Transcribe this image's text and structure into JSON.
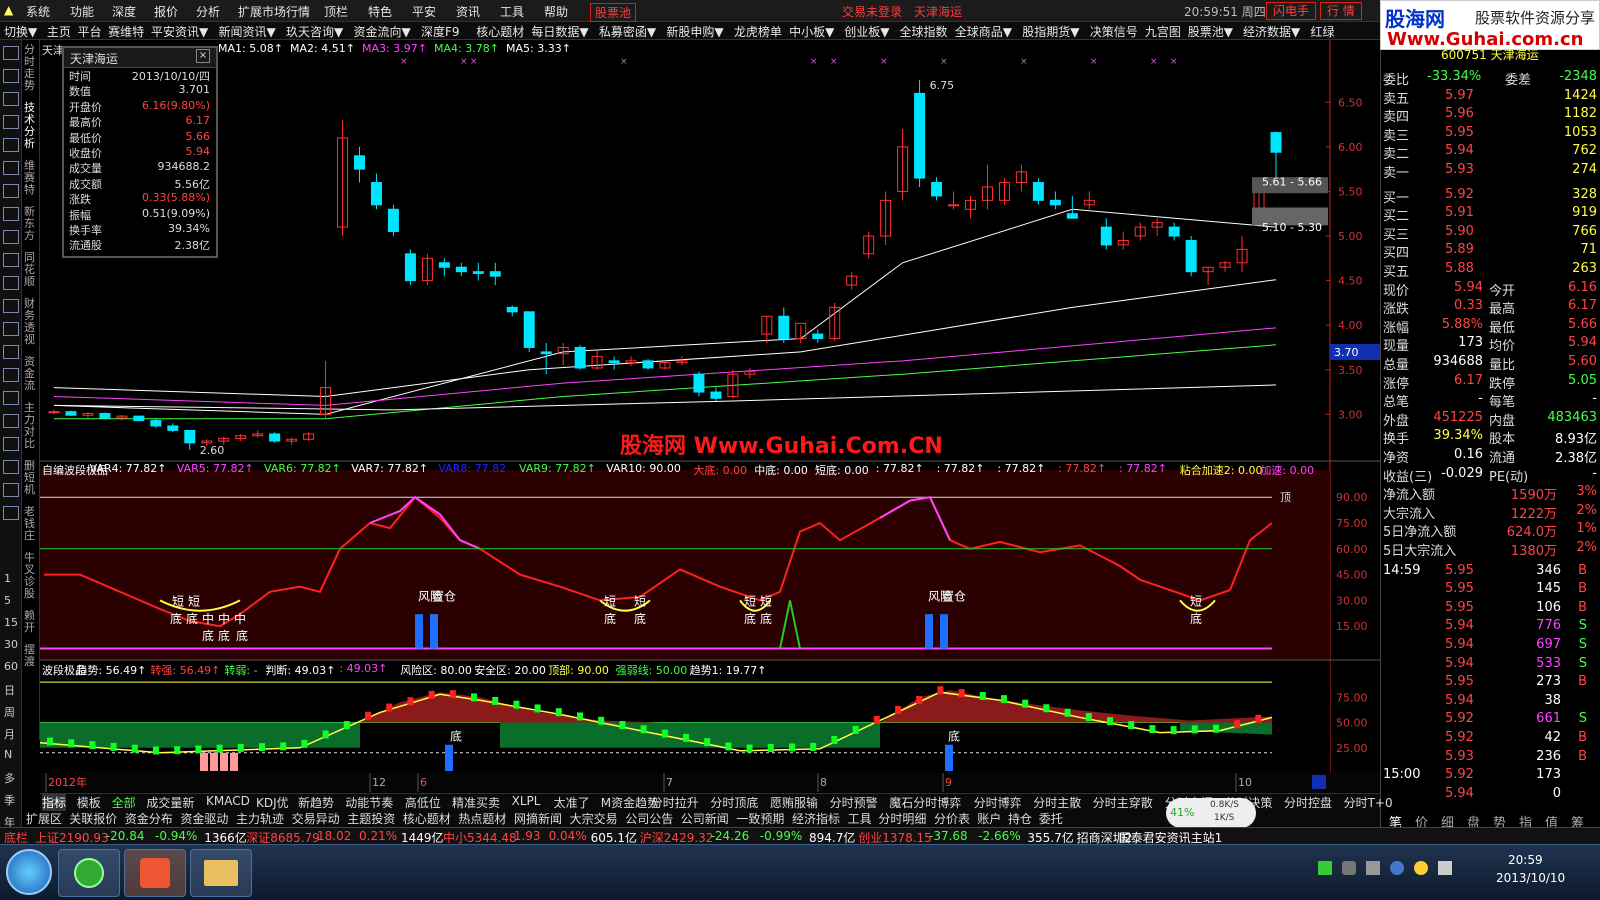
{
  "menubar": {
    "items": [
      "系统",
      "功能",
      "深度",
      "报价",
      "分析",
      "扩展市场行情",
      "顶栏",
      "特色",
      "平安",
      "资讯",
      "工具",
      "帮助"
    ],
    "stock_pool": "股票池",
    "login_status": "交易未登录",
    "stock_name": "天津海运",
    "clock": "20:59:51 周四",
    "flash_btn": "闪电手",
    "quote_btn": "行 情"
  },
  "toolbar": {
    "items": [
      "切换▼",
      "主页",
      "平台",
      "赛维特",
      "平安资讯▼",
      "新闻资讯▼",
      "玖天咨询▼",
      "资金流向▼",
      "深度F9",
      "核心题材",
      "每日数据▼",
      "私募密函▼",
      "新股申购▼",
      "龙虎榜单",
      "中小板▼",
      "创业板▼",
      "全球指数",
      "全球商品▼",
      "股指期货▼",
      "决策信号",
      "九宫图",
      "股票池▼",
      "经济数据▼",
      "红绿"
    ]
  },
  "logo": {
    "name": "股海网",
    "slogan": "股票软件资源分享",
    "url": "Www.Guhai.com.cn"
  },
  "watermark": "股海网 Www.Guhai.Com.CN",
  "left_rail": {
    "icons": [
      "lock-icon",
      "arrow-up-icon",
      "arrow-down-icon",
      "list-icon",
      "grid-icon",
      "line-icon",
      "kline-icon",
      "table-icon",
      "f10-icon",
      "chart-icon",
      "calendar-icon",
      "fiz-icon",
      "f10b-icon",
      "circle-icon",
      "wave-icon",
      "rsi-icon",
      "dollar-icon",
      "cross-icon",
      "pen-icon",
      "f5-icon",
      "book-icon"
    ],
    "periods": [
      "1",
      "5",
      "15",
      "30",
      "60",
      "日",
      "周",
      "月",
      "N",
      "多",
      "季",
      "年"
    ]
  },
  "vtabs": [
    "分时走势",
    "技术分析",
    "维赛特",
    "新东方",
    "同花顺",
    "财务透视",
    "资金流",
    "主力对比",
    "删短机",
    "老钱庄",
    "牛叉诊股",
    "赖开",
    "摆渡"
  ],
  "main_panel": {
    "stock_label": "天津",
    "ma_line": [
      {
        "label": "MA1: 5.08↑",
        "color": "#ffffff"
      },
      {
        "label": "MA2: 4.51↑",
        "color": "#ffffff"
      },
      {
        "label": "MA3: 3.97↑",
        "color": "#ff44ff"
      },
      {
        "label": "MA4: 3.78↑",
        "color": "#44ff44"
      },
      {
        "label": "MA5: 3.33↑",
        "color": "#ffffff"
      }
    ],
    "price_high": "6.75",
    "price_low": "2.60",
    "zone_high": "5.61 - 5.66",
    "zone_low": "5.10 - 5.30",
    "current_tag": "3.70",
    "y_ticks": [
      "6.50",
      "6.00",
      "5.50",
      "5.00",
      "4.50",
      "4.00",
      "3.50",
      "3.00"
    ]
  },
  "info_box": {
    "title": "天津海运",
    "close": "×",
    "rows": [
      {
        "k": "时间",
        "v": "2013/10/10/四",
        "c": "#dddddd"
      },
      {
        "k": "数值",
        "v": "3.701",
        "c": "#dddddd"
      },
      {
        "k": "开盘价",
        "v": "6.16(9.80%)",
        "c": "#ff4444"
      },
      {
        "k": "最高价",
        "v": "6.17",
        "c": "#ff4444"
      },
      {
        "k": "最低价",
        "v": "5.66",
        "c": "#ff4444"
      },
      {
        "k": "收盘价",
        "v": "5.94",
        "c": "#ff4444"
      },
      {
        "k": "成交量",
        "v": "934688.2",
        "c": "#dddddd"
      },
      {
        "k": "成交额",
        "v": "5.56亿",
        "c": "#dddddd"
      },
      {
        "k": "涨跌",
        "v": "0.33(5.88%)",
        "c": "#ff4444"
      },
      {
        "k": "振幅",
        "v": "0.51(9.09%)",
        "c": "#dddddd"
      },
      {
        "k": "换手率",
        "v": "39.34%",
        "c": "#dddddd"
      },
      {
        "k": "流通股",
        "v": "2.38亿",
        "c": "#dddddd"
      }
    ]
  },
  "indicator1": {
    "header": [
      {
        "t": "自编波段极品",
        "c": "#ffffff"
      },
      {
        "t": "VAR4: 77.82↑",
        "c": "#ffffff"
      },
      {
        "t": "VAR5: 77.82↑",
        "c": "#ff44ff"
      },
      {
        "t": "VAR6: 77.82↑",
        "c": "#44ff44"
      },
      {
        "t": "VAR7: 77.82↑",
        "c": "#ffffff"
      },
      {
        "t": "VAR8: 77.82",
        "c": "#2222ff"
      },
      {
        "t": "VAR9: 77.82↑",
        "c": "#44ff44"
      },
      {
        "t": "VAR10: 90.00",
        "c": "#ffffff"
      },
      {
        "t": "大底: 0.00",
        "c": "#ff4444"
      },
      {
        "t": "中底: 0.00",
        "c": "#ffffff"
      },
      {
        "t": "短底: 0.00",
        "c": "#ffffff"
      },
      {
        "t": ": 77.82↑",
        "c": "#ffffff"
      },
      {
        "t": ": 77.82↑",
        "c": "#ffffff"
      },
      {
        "t": ": 77.82↑",
        "c": "#ffffff"
      },
      {
        "t": ": 77.82↑",
        "c": "#ff4444"
      },
      {
        "t": ": 77.82↑",
        "c": "#ff44ff"
      },
      {
        "t": "粘合加速2: 0.00",
        "c": "#ffff44"
      },
      {
        "t": "加速: 0.00",
        "c": "#ff44ff"
      }
    ],
    "y_ticks": [
      "90.00",
      "75.00",
      "60.00",
      "45.00",
      "30.00",
      "15.00"
    ],
    "top_label": "顶",
    "labels": {
      "short": "短",
      "bottom": "底",
      "mid": "中",
      "risk": "风险",
      "hold": "置仓"
    }
  },
  "indicator2": {
    "header": [
      {
        "t": "波段极品",
        "c": "#ffffff"
      },
      {
        "t": "趋势: 56.49↑",
        "c": "#ffffff"
      },
      {
        "t": "转强: 56.49↑",
        "c": "#ff4444"
      },
      {
        "t": "转弱: -",
        "c": "#44ff44"
      },
      {
        "t": "判断: 49.03↑",
        "c": "#ffffff"
      },
      {
        "t": ": 49.03↑",
        "c": "#ff44ff"
      },
      {
        "t": "风险区: 80.00",
        "c": "#ffffff"
      },
      {
        "t": "安全区: 20.00",
        "c": "#ffffff"
      },
      {
        "t": "顶部: 90.00",
        "c": "#ffff44"
      },
      {
        "t": "强弱线: 50.00",
        "c": "#44ff44"
      },
      {
        "t": "趋势1: 19.77↑",
        "c": "#ffffff"
      }
    ],
    "y_ticks": [
      "75.00",
      "50.00",
      "25.00"
    ],
    "bottom_label": "底"
  },
  "x_axis": {
    "labels": [
      {
        "t": "2012年",
        "c": "#ff4444"
      },
      {
        "t": "12",
        "c": "#aaaaaa"
      },
      {
        "t": "6",
        "c": "#ff4444"
      },
      {
        "t": "7",
        "c": "#aaaaaa"
      },
      {
        "t": "8",
        "c": "#aaaaaa"
      },
      {
        "t": "9",
        "c": "#ff4444"
      },
      {
        "t": "10",
        "c": "#aaaaaa"
      }
    ]
  },
  "right_panel": {
    "header": "600751 天津海运",
    "webi": {
      "k": "委比",
      "v": "-33.34%",
      "k2": "委差",
      "v2": "-2348"
    },
    "asks": [
      {
        "k": "卖五",
        "p": "5.97",
        "v": "1424"
      },
      {
        "k": "卖四",
        "p": "5.96",
        "v": "1182"
      },
      {
        "k": "卖三",
        "p": "5.95",
        "v": "1053"
      },
      {
        "k": "卖二",
        "p": "5.94",
        "v": "762"
      },
      {
        "k": "卖一",
        "p": "5.93",
        "v": "274"
      }
    ],
    "bids": [
      {
        "k": "买一",
        "p": "5.92",
        "v": "328"
      },
      {
        "k": "买二",
        "p": "5.91",
        "v": "919"
      },
      {
        "k": "买三",
        "p": "5.90",
        "v": "766"
      },
      {
        "k": "买四",
        "p": "5.89",
        "v": "71"
      },
      {
        "k": "买五",
        "p": "5.88",
        "v": "263"
      }
    ],
    "stats": [
      {
        "k1": "现价",
        "v1": "5.94",
        "k2": "今开",
        "v2": "6.16",
        "c1": "#ff4444",
        "c2": "#ff4444"
      },
      {
        "k1": "涨跌",
        "v1": "0.33",
        "k2": "最高",
        "v2": "6.17",
        "c1": "#ff4444",
        "c2": "#ff4444"
      },
      {
        "k1": "涨幅",
        "v1": "5.88%",
        "k2": "最低",
        "v2": "5.66",
        "c1": "#ff4444",
        "c2": "#ff4444"
      },
      {
        "k1": "现量",
        "v1": "173",
        "k2": "均价",
        "v2": "5.94",
        "c1": "#ffffff",
        "c2": "#ff4444"
      },
      {
        "k1": "总量",
        "v1": "934688",
        "k2": "量比",
        "v2": "5.60",
        "c1": "#ffffff",
        "c2": "#ff4444"
      },
      {
        "k1": "涨停",
        "v1": "6.17",
        "k2": "跌停",
        "v2": "5.05",
        "c1": "#ff4444",
        "c2": "#44ff44"
      },
      {
        "k1": "总笔",
        "v1": "-",
        "k2": "每笔",
        "v2": "-",
        "c1": "#ffffff",
        "c2": "#ffffff"
      },
      {
        "k1": "外盘",
        "v1": "451225",
        "k2": "内盘",
        "v2": "483463",
        "c1": "#ff4444",
        "c2": "#44ff44"
      },
      {
        "k1": "换手",
        "v1": "39.34%",
        "k2": "股本",
        "v2": "8.93亿",
        "c1": "#ffff44",
        "c2": "#ffffff"
      },
      {
        "k1": "净资",
        "v1": "0.16",
        "k2": "流通",
        "v2": "2.38亿",
        "c1": "#ffffff",
        "c2": "#ffffff"
      },
      {
        "k1": "收益(三)",
        "v1": "-0.029",
        "k2": "PE(动)",
        "v2": "-",
        "c1": "#ffffff",
        "c2": "#ffffff"
      }
    ],
    "flows": [
      {
        "k": "净流入额",
        "v": "1590万",
        "p": "3%"
      },
      {
        "k": "大宗流入",
        "v": "1222万",
        "p": "2%"
      },
      {
        "k": "5日净流入额",
        "v": "624.0万",
        "p": "1%"
      },
      {
        "k": "5日大宗流入",
        "v": "1380万",
        "p": "2%"
      }
    ],
    "ticks": [
      {
        "t": "14:59",
        "p": "5.95",
        "v": "346",
        "s": "B"
      },
      {
        "t": "",
        "p": "5.95",
        "v": "145",
        "s": "B"
      },
      {
        "t": "",
        "p": "5.95",
        "v": "106",
        "s": "B"
      },
      {
        "t": "",
        "p": "5.94",
        "v": "776",
        "s": "S"
      },
      {
        "t": "",
        "p": "5.94",
        "v": "697",
        "s": "S"
      },
      {
        "t": "",
        "p": "5.94",
        "v": "533",
        "s": "S"
      },
      {
        "t": "",
        "p": "5.95",
        "v": "273",
        "s": "B"
      },
      {
        "t": "",
        "p": "5.94",
        "v": "38",
        "s": ""
      },
      {
        "t": "",
        "p": "5.92",
        "v": "661",
        "s": "S"
      },
      {
        "t": "",
        "p": "5.92",
        "v": "42",
        "s": "B"
      },
      {
        "t": "",
        "p": "5.93",
        "v": "236",
        "s": "B"
      },
      {
        "t": "15:00",
        "p": "5.92",
        "v": "173",
        "s": ""
      },
      {
        "t": "",
        "p": "5.94",
        "v": "0",
        "s": ""
      }
    ],
    "switch": "切换",
    "tabs": [
      "笔",
      "价",
      "细",
      "盘",
      "势",
      "指",
      "值",
      "筹"
    ]
  },
  "bottom_tabs": {
    "row1": [
      "指标",
      "模板",
      "全部",
      "成交量新",
      "KMACD",
      "KDJ优",
      "新趋势",
      "动能节奏",
      "高低位",
      "精准买卖",
      "XLPL",
      "太准了",
      "M资金趋势",
      "分时拉升",
      "分时顶底",
      "愿贿服输",
      "分时预警",
      "魔石分时博弈",
      "分时博弈",
      "分时主散",
      "分时主穿散",
      "分时启爆",
      "分时决策",
      "分时控盘",
      "分时T+0"
    ],
    "row2": [
      "扩展区",
      "关联报价",
      "资金分布",
      "资金驱动",
      "主力轨迹",
      "交易异动",
      "主题投资",
      "核心题材",
      "热点题材",
      "网摘新闻",
      "大宗交易",
      "公司公告",
      "公司新闻",
      "一致预期",
      "经济指标",
      "工具",
      "分时明细",
      "分价表",
      "账户",
      "持仓",
      "委托"
    ],
    "net": {
      "pct": "41%",
      "up": "0.8K/S",
      "down": "1K/S"
    }
  },
  "ticker": [
    {
      "t": "底栏",
      "c": "#ff4444"
    },
    {
      "t": "上证2190.93",
      "c": "#ff4444"
    },
    {
      "t": "-20.84",
      "c": "#44ff44"
    },
    {
      "t": "-0.94%",
      "c": "#44ff44"
    },
    {
      "t": "1366亿",
      "c": "#ffffff"
    },
    {
      "t": "深证8685.79",
      "c": "#ff4444"
    },
    {
      "t": "18.02",
      "c": "#ff4444"
    },
    {
      "t": "0.21%",
      "c": "#ff4444"
    },
    {
      "t": "1449亿",
      "c": "#ffffff"
    },
    {
      "t": "中小5344.48",
      "c": "#ff4444"
    },
    {
      "t": "1.93",
      "c": "#ff4444"
    },
    {
      "t": "0.04%",
      "c": "#ff4444"
    },
    {
      "t": "605.1亿",
      "c": "#ffffff"
    },
    {
      "t": "沪深2429.32",
      "c": "#ff4444"
    },
    {
      "t": "-24.26",
      "c": "#44ff44"
    },
    {
      "t": "-0.99%",
      "c": "#44ff44"
    },
    {
      "t": "894.7亿",
      "c": "#ffffff"
    },
    {
      "t": "创业1378.15",
      "c": "#ff4444"
    },
    {
      "t": "-37.68",
      "c": "#44ff44"
    },
    {
      "t": "-2.66%",
      "c": "#44ff44"
    },
    {
      "t": "355.7亿",
      "c": "#ffffff"
    },
    {
      "t": "招商深圳2",
      "c": "#ffffff"
    },
    {
      "t": "国泰君安资讯主站1",
      "c": "#ffffff"
    }
  ],
  "taskbar": {
    "time": "20:59",
    "date": "2013/10/10"
  },
  "chart_data": {
    "type": "candlestick",
    "candles": [
      [
        3.02,
        3.05,
        3.0,
        3.03
      ],
      [
        3.03,
        3.04,
        2.98,
        2.99
      ],
      [
        2.99,
        3.02,
        2.96,
        3.01
      ],
      [
        3.01,
        3.02,
        2.95,
        2.96
      ],
      [
        2.96,
        2.99,
        2.93,
        2.98
      ],
      [
        2.98,
        2.98,
        2.92,
        2.93
      ],
      [
        2.93,
        2.95,
        2.85,
        2.87
      ],
      [
        2.87,
        2.9,
        2.8,
        2.82
      ],
      [
        2.82,
        2.82,
        2.6,
        2.68
      ],
      [
        2.68,
        2.72,
        2.64,
        2.7
      ],
      [
        2.7,
        2.75,
        2.66,
        2.73
      ],
      [
        2.73,
        2.78,
        2.7,
        2.76
      ],
      [
        2.76,
        2.82,
        2.74,
        2.78
      ],
      [
        2.78,
        2.8,
        2.68,
        2.7
      ],
      [
        2.7,
        2.74,
        2.66,
        2.72
      ],
      [
        2.72,
        2.8,
        2.7,
        2.78
      ],
      [
        3.0,
        3.6,
        2.95,
        3.3
      ],
      [
        5.1,
        6.3,
        5.0,
        6.1
      ],
      [
        5.9,
        6.0,
        5.6,
        5.75
      ],
      [
        5.6,
        5.7,
        5.3,
        5.35
      ],
      [
        5.3,
        5.35,
        5.0,
        5.05
      ],
      [
        4.8,
        4.85,
        4.45,
        4.5
      ],
      [
        4.5,
        4.8,
        4.45,
        4.75
      ],
      [
        4.7,
        4.75,
        4.55,
        4.65
      ],
      [
        4.65,
        4.7,
        4.55,
        4.6
      ],
      [
        4.6,
        4.7,
        4.5,
        4.58
      ],
      [
        4.6,
        4.7,
        4.45,
        4.55
      ],
      [
        4.2,
        4.22,
        4.1,
        4.15
      ],
      [
        4.15,
        4.15,
        3.7,
        3.75
      ],
      [
        3.7,
        3.8,
        3.45,
        3.68
      ],
      [
        3.68,
        3.8,
        3.55,
        3.75
      ],
      [
        3.75,
        3.78,
        3.5,
        3.52
      ],
      [
        3.52,
        3.72,
        3.5,
        3.65
      ],
      [
        3.6,
        3.65,
        3.5,
        3.58
      ],
      [
        3.58,
        3.65,
        3.54,
        3.6
      ],
      [
        3.6,
        3.62,
        3.5,
        3.52
      ],
      [
        3.52,
        3.6,
        3.5,
        3.58
      ],
      [
        3.58,
        3.65,
        3.55,
        3.6
      ],
      [
        3.45,
        3.48,
        3.2,
        3.25
      ],
      [
        3.25,
        3.3,
        3.15,
        3.18
      ],
      [
        3.2,
        3.5,
        3.18,
        3.45
      ],
      [
        3.45,
        3.52,
        3.4,
        3.48
      ],
      [
        3.9,
        4.1,
        3.8,
        4.1
      ],
      [
        4.1,
        4.2,
        3.8,
        3.85
      ],
      [
        3.85,
        4.0,
        3.8,
        4.02
      ],
      [
        3.9,
        3.95,
        3.8,
        3.85
      ],
      [
        3.85,
        4.25,
        3.82,
        4.2
      ],
      [
        4.45,
        4.6,
        4.4,
        4.55
      ],
      [
        4.8,
        5.05,
        4.75,
        5.0
      ],
      [
        5.0,
        5.5,
        4.9,
        5.4
      ],
      [
        5.5,
        6.2,
        5.4,
        6.0
      ],
      [
        6.6,
        6.75,
        5.55,
        5.65
      ],
      [
        5.6,
        5.66,
        5.4,
        5.45
      ],
      [
        5.35,
        5.5,
        5.3,
        5.35
      ],
      [
        5.3,
        5.45,
        5.2,
        5.4
      ],
      [
        5.4,
        5.8,
        5.3,
        5.55
      ],
      [
        5.4,
        5.65,
        5.35,
        5.6
      ],
      [
        5.6,
        5.8,
        5.5,
        5.72
      ],
      [
        5.6,
        5.65,
        5.35,
        5.4
      ],
      [
        5.4,
        5.5,
        5.3,
        5.35
      ],
      [
        5.25,
        5.45,
        5.2,
        5.2
      ],
      [
        5.35,
        5.5,
        5.3,
        5.4
      ],
      [
        5.1,
        5.2,
        4.85,
        4.9
      ],
      [
        4.9,
        5.05,
        4.85,
        4.95
      ],
      [
        5.0,
        5.15,
        4.95,
        5.1
      ],
      [
        5.1,
        5.2,
        5.0,
        5.15
      ],
      [
        5.1,
        5.15,
        4.95,
        5.0
      ],
      [
        4.95,
        5.0,
        4.55,
        4.6
      ],
      [
        4.6,
        4.65,
        4.45,
        4.65
      ],
      [
        4.65,
        4.72,
        4.6,
        4.7
      ],
      [
        4.7,
        5.0,
        4.6,
        4.85
      ],
      [
        5.3,
        5.6,
        5.2,
        5.55
      ],
      [
        6.16,
        6.17,
        5.66,
        5.94
      ]
    ],
    "ma_series": [
      {
        "name": "MA1",
        "color": "#ffffff",
        "points": [
          [
            0,
            3.1
          ],
          [
            16,
            3.0
          ],
          [
            30,
            3.7
          ],
          [
            44,
            3.85
          ],
          [
            50,
            4.7
          ],
          [
            60,
            5.3
          ],
          [
            72,
            5.1
          ]
        ]
      },
      {
        "name": "MA2",
        "color": "#ffffff",
        "points": [
          [
            0,
            3.3
          ],
          [
            16,
            3.2
          ],
          [
            28,
            3.5
          ],
          [
            44,
            3.7
          ],
          [
            60,
            4.2
          ],
          [
            72,
            4.51
          ]
        ]
      },
      {
        "name": "MA3",
        "color": "#ff44ff",
        "points": [
          [
            0,
            3.2
          ],
          [
            16,
            3.1
          ],
          [
            30,
            3.35
          ],
          [
            50,
            3.6
          ],
          [
            72,
            3.97
          ]
        ]
      },
      {
        "name": "MA4",
        "color": "#44ff44",
        "points": [
          [
            0,
            2.95
          ],
          [
            16,
            2.95
          ],
          [
            30,
            3.2
          ],
          [
            50,
            3.45
          ],
          [
            72,
            3.78
          ]
        ]
      },
      {
        "name": "MA5",
        "color": "#ffffff",
        "points": [
          [
            0,
            3.1
          ],
          [
            20,
            3.05
          ],
          [
            40,
            3.15
          ],
          [
            72,
            3.33
          ]
        ]
      }
    ],
    "ylim": [
      2.6,
      6.75
    ]
  }
}
